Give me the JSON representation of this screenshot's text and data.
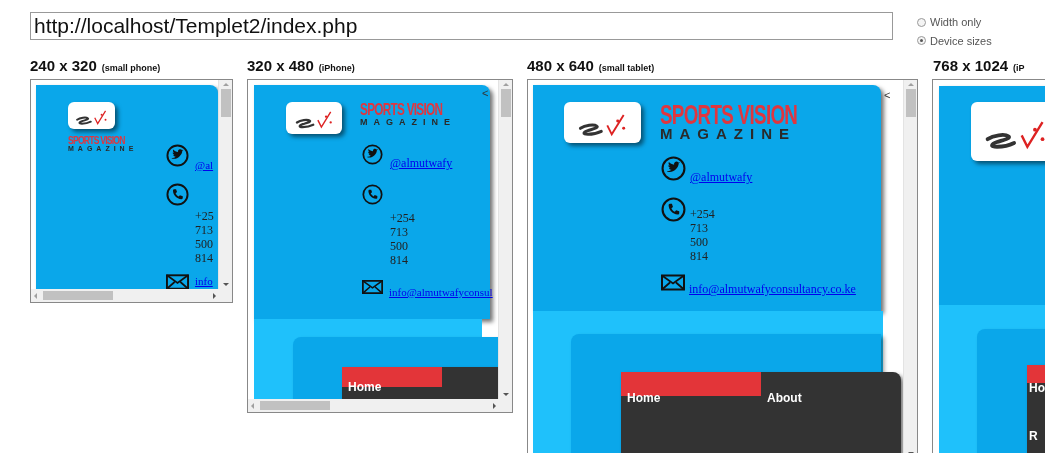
{
  "url_field": {
    "value": "http://localhost/Templet2/index.php"
  },
  "view_options": [
    {
      "label": "Width only",
      "selected": false
    },
    {
      "label": "Device sizes",
      "selected": true
    }
  ],
  "frames": [
    {
      "size": "240 x 320",
      "device": "(small phone)",
      "page": {
        "title": [
          "SPORTS VISION",
          "MAGAZINE"
        ],
        "twitter": "@al",
        "phone": [
          "+25",
          "713",
          "500",
          "814"
        ],
        "email": "info"
      }
    },
    {
      "size": "320 x 480",
      "device": "(iPhone)",
      "page": {
        "back": "<",
        "title": [
          "SPORTS VISION",
          "MAGAZINE"
        ],
        "twitter": "@almutwafy",
        "phone": [
          "+254",
          "713",
          "500",
          "814"
        ],
        "email": "info@almutwafyconsul",
        "menu": [
          {
            "label": "Home",
            "selected": true
          }
        ]
      }
    },
    {
      "size": "480 x 640",
      "device": "(small tablet)",
      "page": {
        "back": "<",
        "title": [
          "SPORTS VISION",
          "MAGAZINE"
        ],
        "twitter": "@almutwafy",
        "phone": [
          "+254",
          "713",
          "500",
          "814"
        ],
        "email": "info@almutwafyconsultancy.co.ke",
        "menu": [
          {
            "label": "Home",
            "selected": true
          },
          {
            "label": "About",
            "selected": false
          }
        ]
      }
    },
    {
      "size": "768 x 1024",
      "device": "(iP",
      "page": {
        "menu": [
          {
            "label": "Ho",
            "selected": true
          },
          {
            "label": "R",
            "selected": false
          }
        ]
      }
    }
  ]
}
